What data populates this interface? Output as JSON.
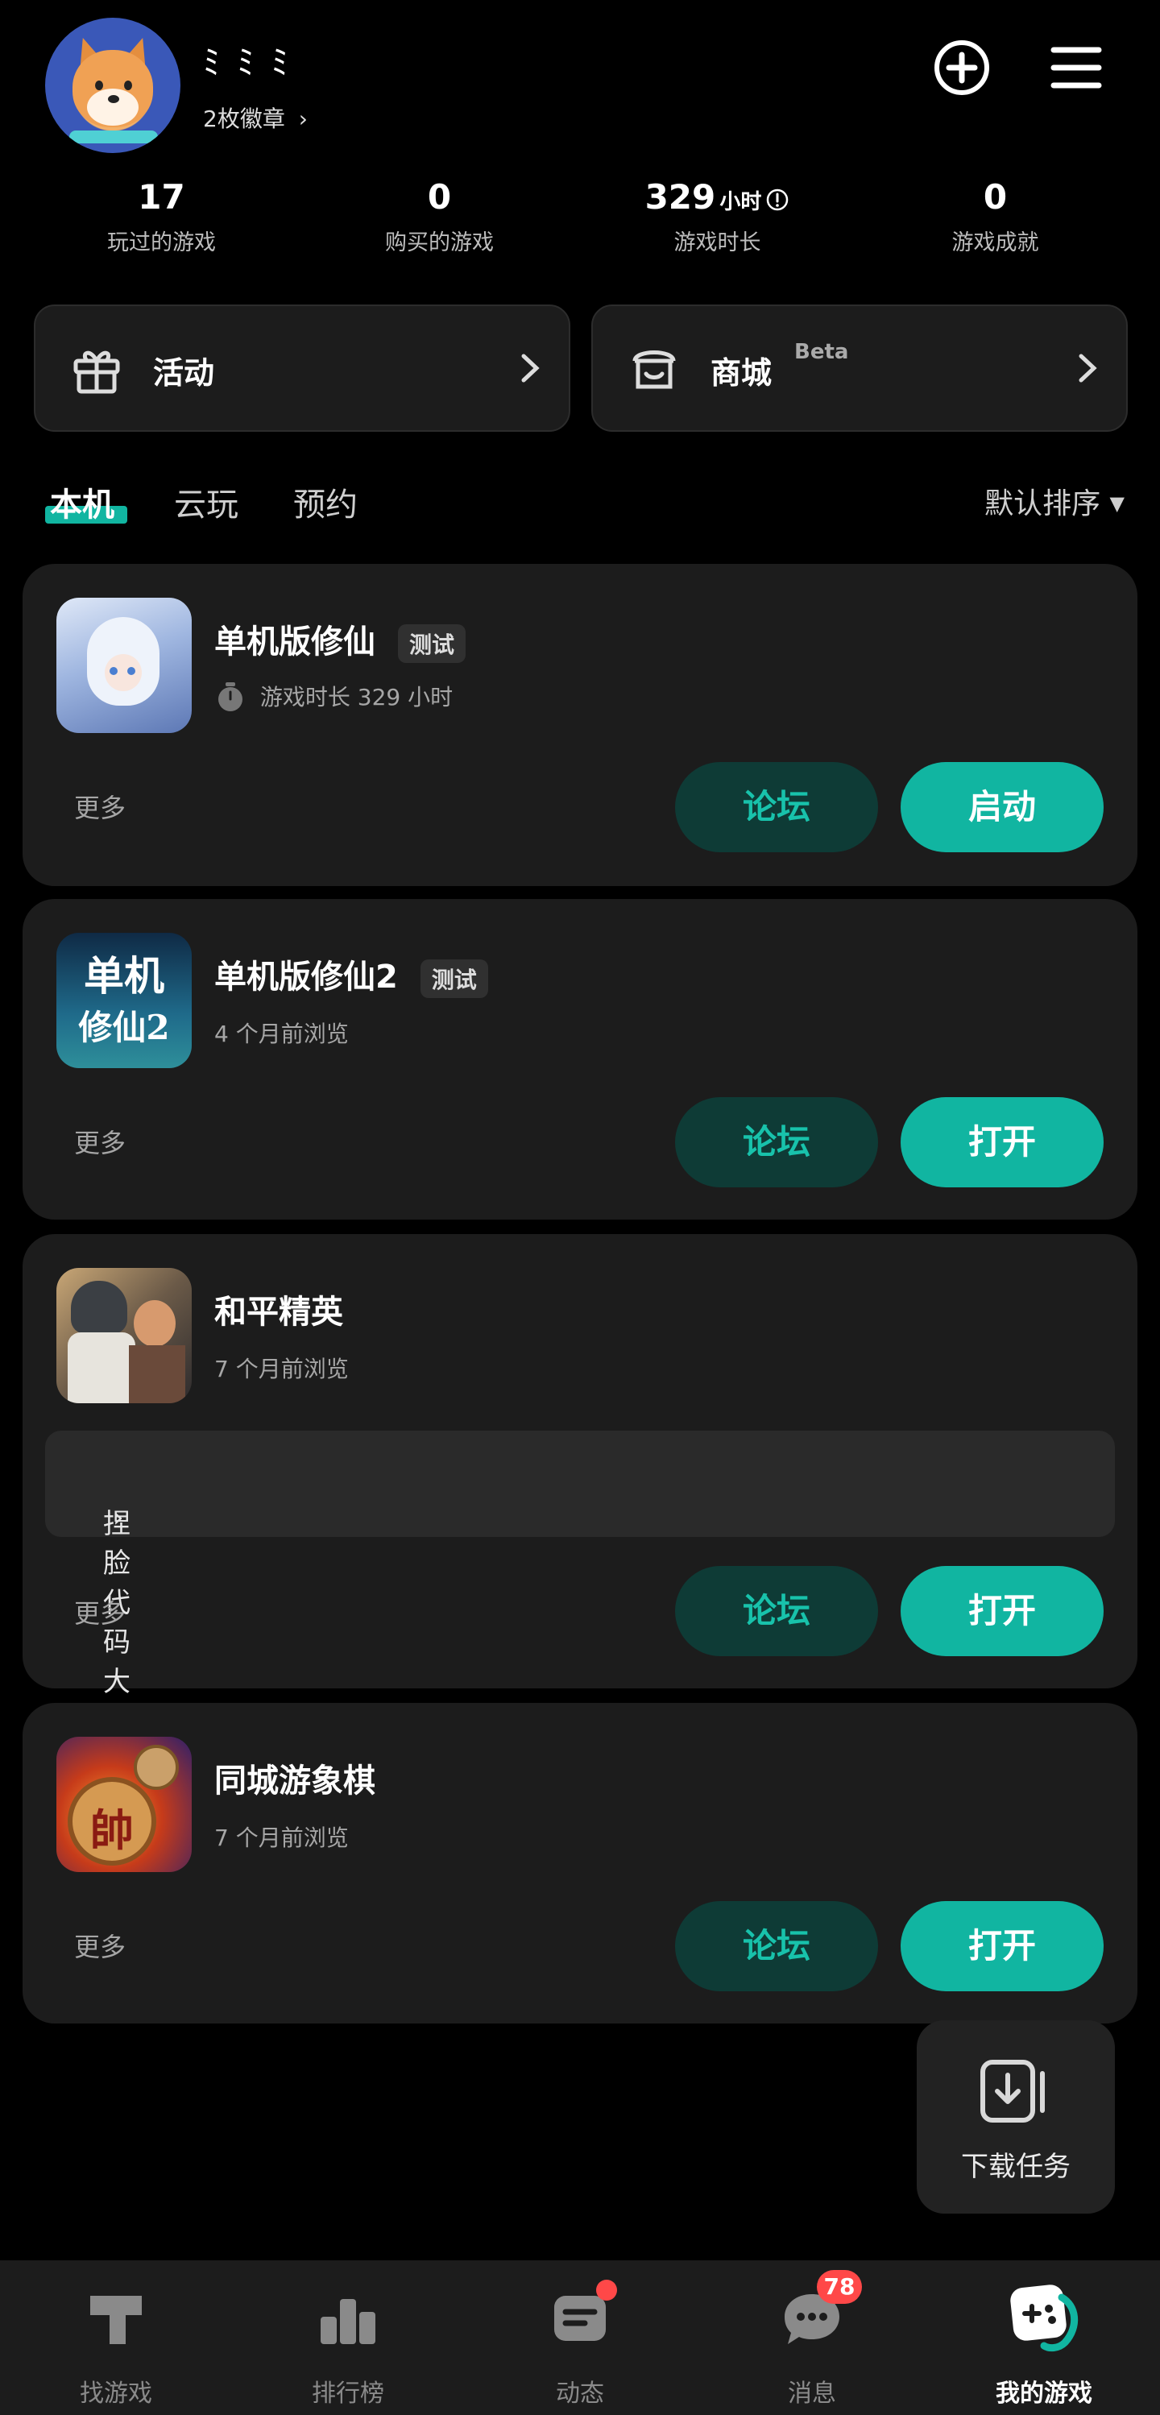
{
  "header": {
    "username": "ﾐ ﾐ ﾐ",
    "badges": "2枚徽章",
    "add_icon": "plus-circle-icon",
    "menu_icon": "menu-icon"
  },
  "stats": [
    {
      "value": "17",
      "unit": "",
      "label": "玩过的游戏"
    },
    {
      "value": "0",
      "unit": "",
      "label": "购买的游戏"
    },
    {
      "value": "329",
      "unit": "小时",
      "label": "游戏时长"
    },
    {
      "value": "0",
      "unit": "",
      "label": "游戏成就"
    }
  ],
  "quick": {
    "activity": "活动",
    "store": "商城",
    "store_badge": "Beta"
  },
  "tabs": [
    "本机",
    "云玩",
    "预约"
  ],
  "sort_label": "默认排序",
  "games": [
    {
      "title": "单机版修仙",
      "tag": "测试",
      "sub": "游戏时长 329 小时",
      "more": "更多",
      "forum": "论坛",
      "action": "启动"
    },
    {
      "title": "单机版修仙2",
      "tag": "测试",
      "sub": "4 个月前浏览",
      "more": "更多",
      "forum": "论坛",
      "action": "打开"
    },
    {
      "title": "和平精英",
      "tag": "",
      "sub": "7 个月前浏览",
      "promo": "捏脸代码大全🔥",
      "more": "更多",
      "forum": "论坛",
      "action": "打开"
    },
    {
      "title": "同城游象棋",
      "tag": "",
      "sub": "7 个月前浏览",
      "more": "更多",
      "forum": "论坛",
      "action": "打开"
    }
  ],
  "game2_icon_text": [
    "单机",
    "修仙2"
  ],
  "game4_icon_text": "帥",
  "download_label": "下载任务",
  "nav": [
    {
      "label": "找游戏"
    },
    {
      "label": "排行榜"
    },
    {
      "label": "动态"
    },
    {
      "label": "消息",
      "badge": "78"
    },
    {
      "label": "我的游戏"
    }
  ],
  "colors": {
    "accent": "#11b5a1",
    "forum_bg": "#0e3b36",
    "badge": "#ff4848"
  }
}
